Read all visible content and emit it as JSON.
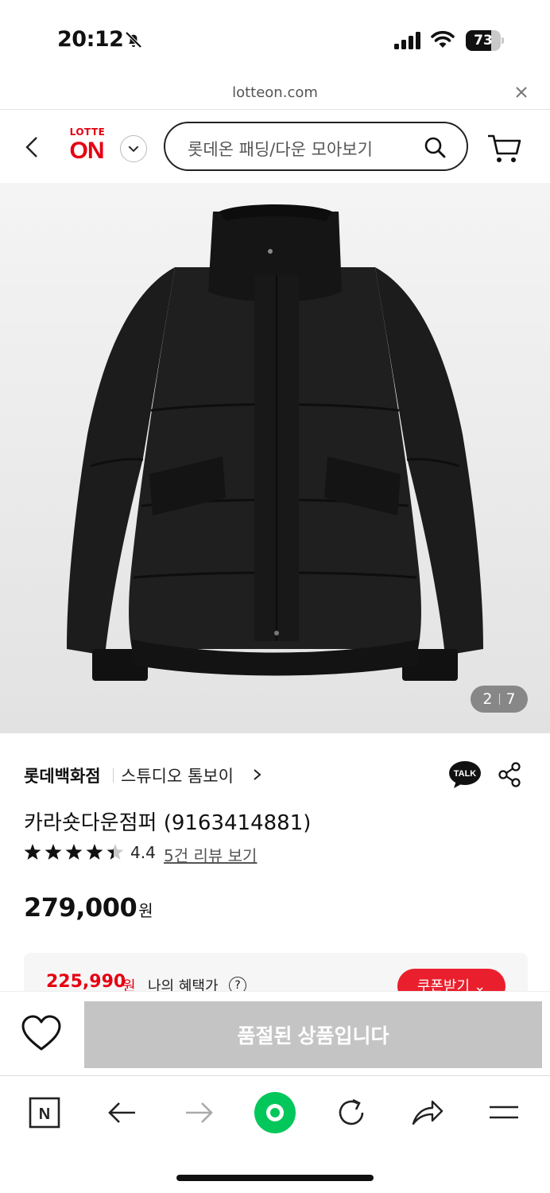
{
  "status_bar": {
    "time": "20:12",
    "battery": "73",
    "battery_level": 0.73
  },
  "browser": {
    "url": "lotteon.com"
  },
  "header": {
    "logo_top": "LOTTE",
    "logo_main": "ON",
    "search_placeholder": "롯데온 패딩/다운 모아보기"
  },
  "gallery": {
    "current": "2",
    "total": "7"
  },
  "product": {
    "brand": "롯데백화점",
    "store": "스튜디오 톰보이",
    "title": "카라숏다운점퍼 (9163414881)",
    "rating": "4.4",
    "rating_stars": 4.4,
    "review_link": "5건 리뷰 보기",
    "price": "279,000",
    "price_unit": "원"
  },
  "benefit": {
    "price": "225,990",
    "unit": "원",
    "label": "나의 혜택가",
    "help": "?",
    "coupon_button": "쿠폰받기"
  },
  "cta": {
    "soldout_label": "품절된 상품입니다"
  },
  "colors": {
    "brand_red": "#e60012",
    "coupon_red": "#ea1f2d",
    "naver_green": "#03c75a",
    "disabled_gray": "#c4c4c4"
  },
  "toolbar": {
    "icons": [
      "naver-n-icon",
      "back-arrow-icon",
      "forward-arrow-icon",
      "green-dot-home-icon",
      "refresh-icon",
      "share-arrow-icon",
      "menu-icon"
    ]
  }
}
